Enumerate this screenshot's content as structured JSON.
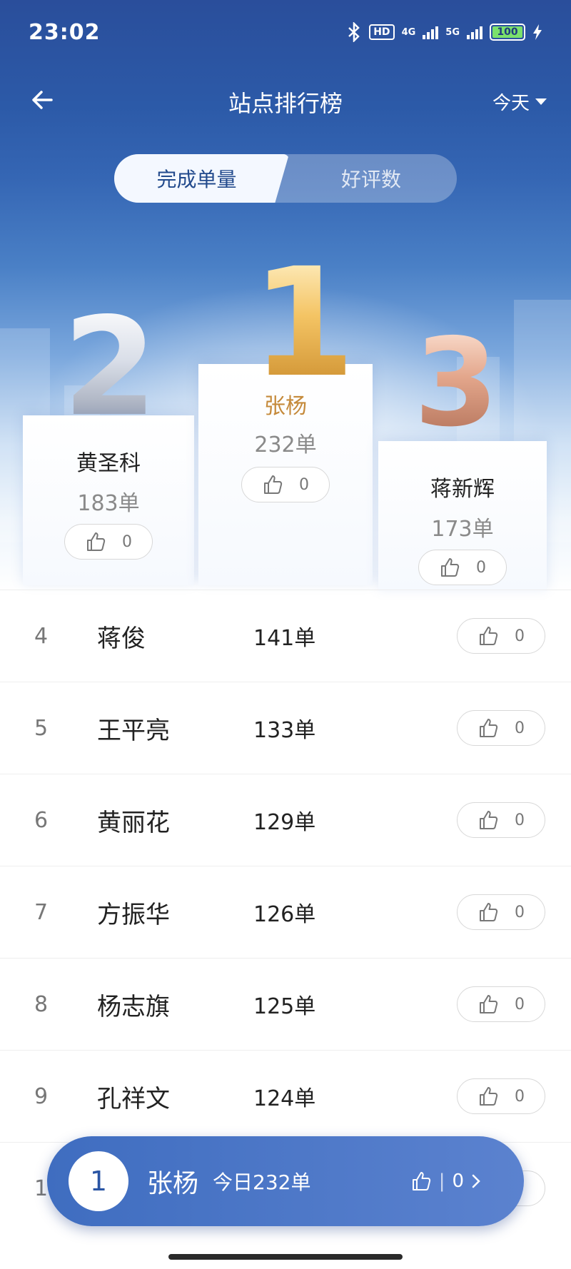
{
  "status": {
    "time": "23:02",
    "hd": "HD",
    "net1": "4G",
    "net2": "5G",
    "battery": "100"
  },
  "nav": {
    "title": "站点排行榜",
    "date_filter": "今天"
  },
  "tabs": [
    {
      "label": "完成单量",
      "active": true
    },
    {
      "label": "好评数",
      "active": false
    }
  ],
  "podium": {
    "first": {
      "rank": "1",
      "name": "张杨",
      "count": "232单",
      "likes": "0"
    },
    "second": {
      "rank": "2",
      "name": "黄圣科",
      "count": "183单",
      "likes": "0"
    },
    "third": {
      "rank": "3",
      "name": "蒋新辉",
      "count": "173单",
      "likes": "0"
    }
  },
  "list": [
    {
      "rank": "4",
      "name": "蒋俊",
      "count": "141单",
      "likes": "0"
    },
    {
      "rank": "5",
      "name": "王平亮",
      "count": "133单",
      "likes": "0"
    },
    {
      "rank": "6",
      "name": "黄丽花",
      "count": "129单",
      "likes": "0"
    },
    {
      "rank": "7",
      "name": "方振华",
      "count": "126单",
      "likes": "0"
    },
    {
      "rank": "8",
      "name": "杨志旗",
      "count": "125单",
      "likes": "0"
    },
    {
      "rank": "9",
      "name": "孔祥文",
      "count": "124单",
      "likes": "0"
    },
    {
      "rank": "10",
      "name": "",
      "count": "",
      "likes": ""
    }
  ],
  "my_rank": {
    "rank": "1",
    "name": "张杨",
    "today": "今日232单",
    "likes": "0",
    "sep": "|"
  },
  "colors": {
    "primary": "#2c5aa8",
    "gold": "#e6b04f",
    "silver": "#a9b0bf",
    "bronze": "#d49a80"
  }
}
